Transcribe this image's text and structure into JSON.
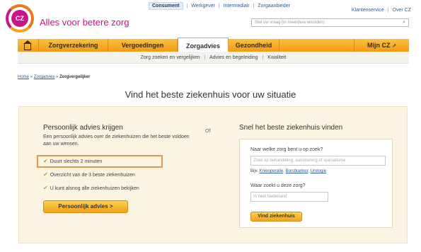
{
  "brand": {
    "logo_text": "CZ",
    "tagline": "Alles voor betere zorg"
  },
  "topnav": {
    "active": "Consument",
    "items": [
      "Werkgever",
      "Intermediair",
      "Zorgaanbieder"
    ]
  },
  "toplinks": {
    "klantenservice": "Klantenservice",
    "over": "Over CZ"
  },
  "search": {
    "placeholder": "Stel uw vraag (in meerdere woorden)"
  },
  "mainnav": {
    "items": [
      "Zorgverzekering",
      "Vergoedingen",
      "Zorgadvies",
      "Gezondheid"
    ],
    "active": "Zorgadvies",
    "mijn": "Mijn CZ"
  },
  "subnav": {
    "items": [
      "Zorg zoeken en vergelijken",
      "Advies en begeleiding",
      "Kwaliteit"
    ]
  },
  "breadcrumb": {
    "home": "Home",
    "zorgadvies": "Zorgadvies",
    "current": "Zorgvergelijker"
  },
  "page": {
    "title": "Vind het beste ziekenhuis voor uw situatie"
  },
  "left": {
    "heading": "Persoonlijk advies krijgen",
    "text": "Een persoonlijk advies over de ziekenhuizen die het beste voldoen aan uw wensen.",
    "checks": [
      "Duurt slechts 2 minuten",
      "Overzicht van de 3 beste ziekenhuizen",
      "U kunt alsnog alle ziekenhuizen bekijken"
    ],
    "button": "Persoonlijk advies >"
  },
  "of": "Of",
  "right": {
    "heading": "Snel het beste ziekenhuis vinden",
    "q1": "Naar welke zorg bent u op zoek?",
    "q1_placeholder": "Zoek op behandeling, aandoening of specialisme",
    "bijv": "Bijv.",
    "examples": [
      "Knieoperatie",
      "Borstkanker",
      "Urologie"
    ],
    "q2": "Waar zoekt u deze zorg?",
    "q2_placeholder": "In heel Nederland",
    "button": "Vind ziekenhuis"
  },
  "colors": {
    "accent": "#f39b14",
    "brand": "#c9148a",
    "link": "#2a5a9c",
    "check": "#8ab832",
    "highlight": "#e09a52"
  }
}
